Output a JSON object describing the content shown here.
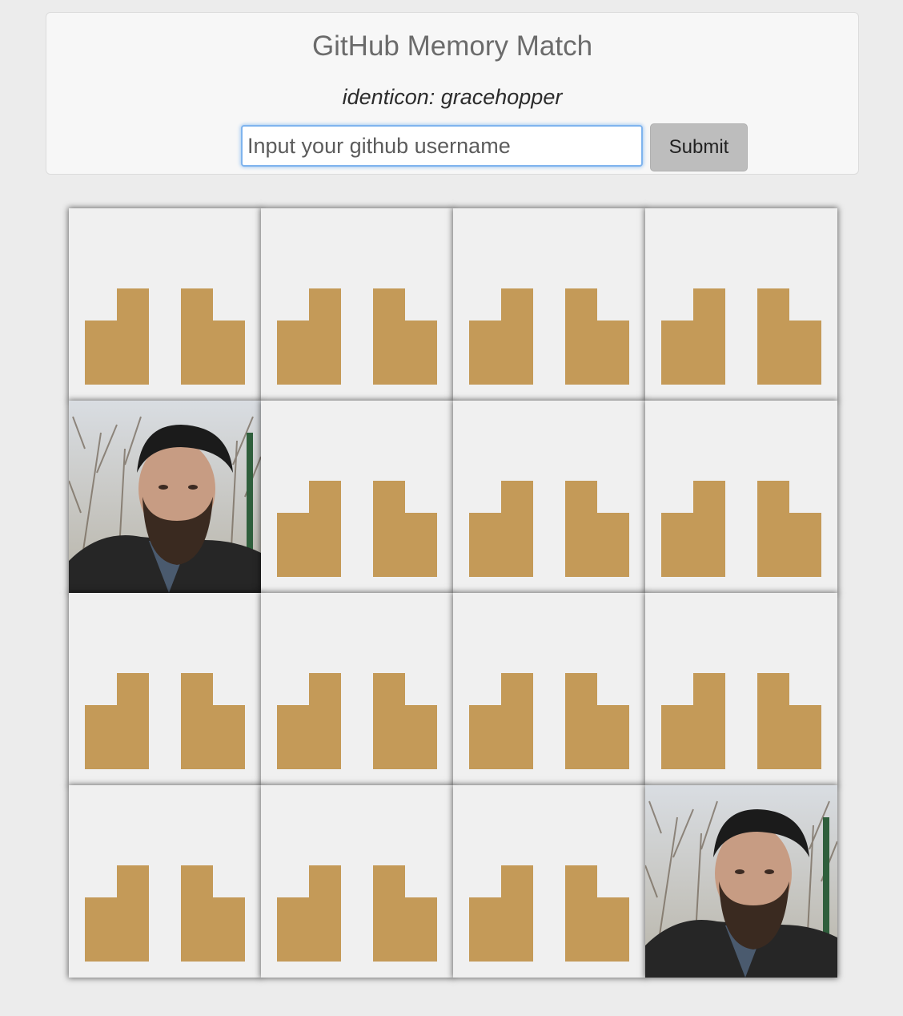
{
  "header": {
    "title": "GitHub Memory Match",
    "subtitle": "identicon: gracehopper",
    "input_placeholder": "Input your github username",
    "input_value": "",
    "submit_label": "Submit"
  },
  "identicon_color": "#c49a58",
  "card_back_color": "#f0f0f0",
  "board": {
    "rows": 4,
    "cols": 4,
    "cards": [
      {
        "state": "face-down",
        "icon": "identicon"
      },
      {
        "state": "face-down",
        "icon": "identicon"
      },
      {
        "state": "face-down",
        "icon": "identicon"
      },
      {
        "state": "face-down",
        "icon": "identicon"
      },
      {
        "state": "face-up",
        "icon": "avatar-photo"
      },
      {
        "state": "face-down",
        "icon": "identicon"
      },
      {
        "state": "face-down",
        "icon": "identicon"
      },
      {
        "state": "face-down",
        "icon": "identicon"
      },
      {
        "state": "face-down",
        "icon": "identicon"
      },
      {
        "state": "face-down",
        "icon": "identicon"
      },
      {
        "state": "face-down",
        "icon": "identicon"
      },
      {
        "state": "face-down",
        "icon": "identicon"
      },
      {
        "state": "face-down",
        "icon": "identicon"
      },
      {
        "state": "face-down",
        "icon": "identicon"
      },
      {
        "state": "face-down",
        "icon": "identicon"
      },
      {
        "state": "face-up",
        "icon": "avatar-photo"
      }
    ]
  }
}
